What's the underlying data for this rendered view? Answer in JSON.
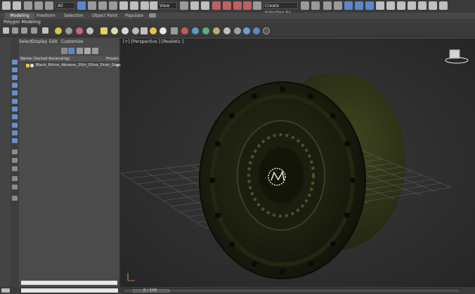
{
  "toolbar": {
    "filter_select": "All",
    "view_select": "View",
    "selection_set_select": "Create Selection Se"
  },
  "ribbon": {
    "tabs": [
      "Modeling",
      "Freeform",
      "Selection",
      "Object Paint",
      "Populate"
    ],
    "sub_label": "Polygon Modeling"
  },
  "explorer": {
    "menu": [
      "Select",
      "Display",
      "Edit",
      "Customize"
    ],
    "header_name": "Name (Sorted Ascending)",
    "header_frozen": "Frozen",
    "object_name": "Black_Rhino_Abrams_20in_Olive_Drab_Green"
  },
  "viewport": {
    "label": "[+] [Perspective ] [Realistic ]"
  },
  "timeline": {
    "frame": "0 / 100"
  },
  "colors": {
    "accent": "#5b86c9",
    "viewport_bg": "#2b2b2b",
    "panel_bg": "#4b4b4b",
    "wheel_olive": "#3a3f1f"
  }
}
